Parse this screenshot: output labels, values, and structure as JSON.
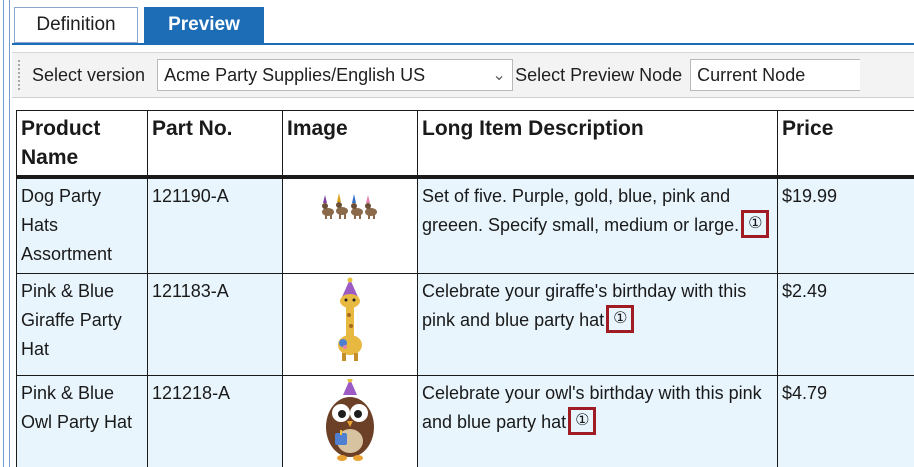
{
  "tabs": [
    {
      "label": "Definition",
      "active": false
    },
    {
      "label": "Preview",
      "active": true
    }
  ],
  "toolbar": {
    "version_label": "Select version",
    "version_value": "Acme Party Supplies/English US",
    "node_label": "Select Preview Node",
    "node_value": "Current Node"
  },
  "table": {
    "headers": {
      "product_name": "Product Name",
      "part_no": "Part No.",
      "image": "Image",
      "description": "Long Item Description",
      "price": "Price"
    },
    "rows": [
      {
        "product_name": "Dog Party Hats Assortment",
        "part_no": "121190-A",
        "image_icon": "dog-party-hats-icon",
        "description": "Set of five. Purple, gold, blue, pink and greeen. Specify small, medium or large.",
        "marker": "①",
        "price": "$19.99"
      },
      {
        "product_name": "Pink & Blue Giraffe Party Hat",
        "part_no": "121183-A",
        "image_icon": "giraffe-party-hat-icon",
        "description": "Celebrate your giraffe's birthday with this pink and blue party hat",
        "marker": "①",
        "price": "$2.49"
      },
      {
        "product_name": "Pink & Blue Owl Party Hat",
        "part_no": "121218-A",
        "image_icon": "owl-party-hat-icon",
        "description": "Celebrate your owl's birthday with this pink and blue party hat",
        "marker": "①",
        "price": "$4.79"
      }
    ]
  },
  "colors": {
    "tab_active": "#1c6db6",
    "row_bg": "#e8f5fd",
    "highlight_box": "#a01c24"
  }
}
